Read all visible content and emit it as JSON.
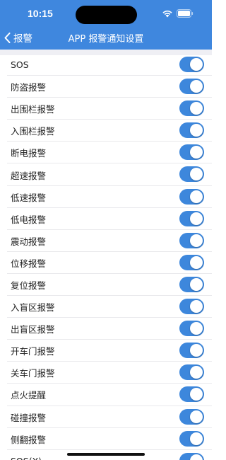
{
  "status_bar": {
    "time": "10:15"
  },
  "nav": {
    "back_label": "报警",
    "title": "APP 报警通知设置"
  },
  "colors": {
    "accent": "#3f87de",
    "switch_on": "#3d87dc",
    "background": "#efeff4"
  },
  "items": [
    {
      "label": "SOS",
      "enabled": true
    },
    {
      "label": "防盗报警",
      "enabled": true
    },
    {
      "label": "出围栏报警",
      "enabled": true
    },
    {
      "label": "入围栏报警",
      "enabled": true
    },
    {
      "label": "断电报警",
      "enabled": true
    },
    {
      "label": "超速报警",
      "enabled": true
    },
    {
      "label": "低速报警",
      "enabled": true
    },
    {
      "label": "低电报警",
      "enabled": true
    },
    {
      "label": "震动报警",
      "enabled": true
    },
    {
      "label": "位移报警",
      "enabled": true
    },
    {
      "label": "复位报警",
      "enabled": true
    },
    {
      "label": "入盲区报警",
      "enabled": true
    },
    {
      "label": "出盲区报警",
      "enabled": true
    },
    {
      "label": "开车门报警",
      "enabled": true
    },
    {
      "label": "关车门报警",
      "enabled": true
    },
    {
      "label": "点火提醒",
      "enabled": true
    },
    {
      "label": "碰撞报警",
      "enabled": true
    },
    {
      "label": "侧翻报警",
      "enabled": true
    },
    {
      "label": "SOS(X)",
      "enabled": true
    }
  ]
}
